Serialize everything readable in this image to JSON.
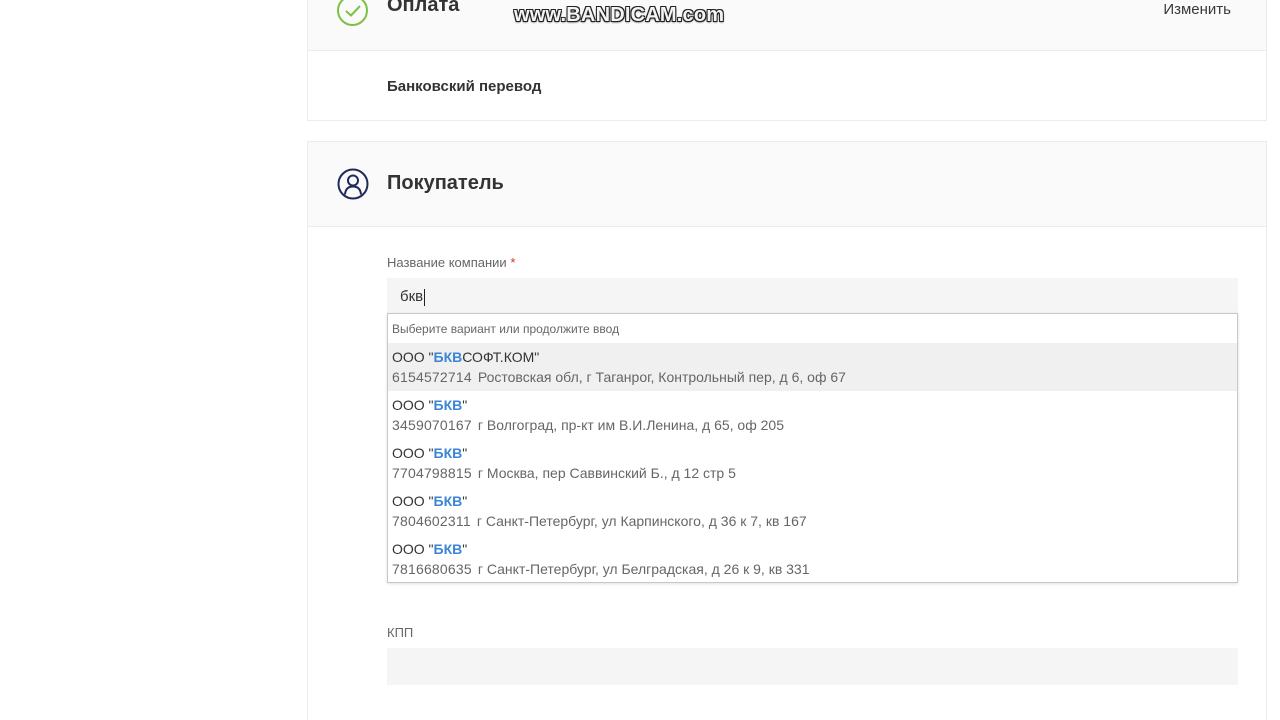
{
  "payment": {
    "title": "Оплата",
    "change_label": "Изменить",
    "method": "Банковский перевод"
  },
  "watermark": "www.BANDICAM.com",
  "buyer": {
    "title": "Покупатель",
    "company_label": "Название компании",
    "required_mark": "*",
    "company_value": "бкв",
    "dropdown_hint": "Выберите вариант или продолжите ввод",
    "suggestions": [
      {
        "prefix": "ООО \"",
        "highlight": "БКВ",
        "suffix": "СОФТ.КОМ\"",
        "inn": "6154572714",
        "address": "Ростовская обл, г Таганрог, Контрольный пер, д 6, оф 67"
      },
      {
        "prefix": "ООО \"",
        "highlight": "БКВ",
        "suffix": "\"",
        "inn": "3459070167",
        "address": "г Волгоград, пр-кт им В.И.Ленина, д 65, оф 205"
      },
      {
        "prefix": "ООО \"",
        "highlight": "БКВ",
        "suffix": "\"",
        "inn": "7704798815",
        "address": "г Москва, пер Саввинский Б., д 12 стр 5"
      },
      {
        "prefix": "ООО \"",
        "highlight": "БКВ",
        "suffix": "\"",
        "inn": "7804602311",
        "address": "г Санкт-Петербург, ул Карпинского, д 36 к 7, кв 167"
      },
      {
        "prefix": "ООО \"",
        "highlight": "БКВ",
        "suffix": "\"",
        "inn": "7816680635",
        "address": "г Санкт-Петербург, ул Белградская, д 26 к 9, кв 331"
      }
    ],
    "kpp_label": "КПП",
    "kpp_value": ""
  },
  "colors": {
    "check_green": "#7cc142",
    "icon_navy": "#1f2a5a",
    "highlight_blue": "#3b86d4",
    "required_red": "#d0332c"
  }
}
